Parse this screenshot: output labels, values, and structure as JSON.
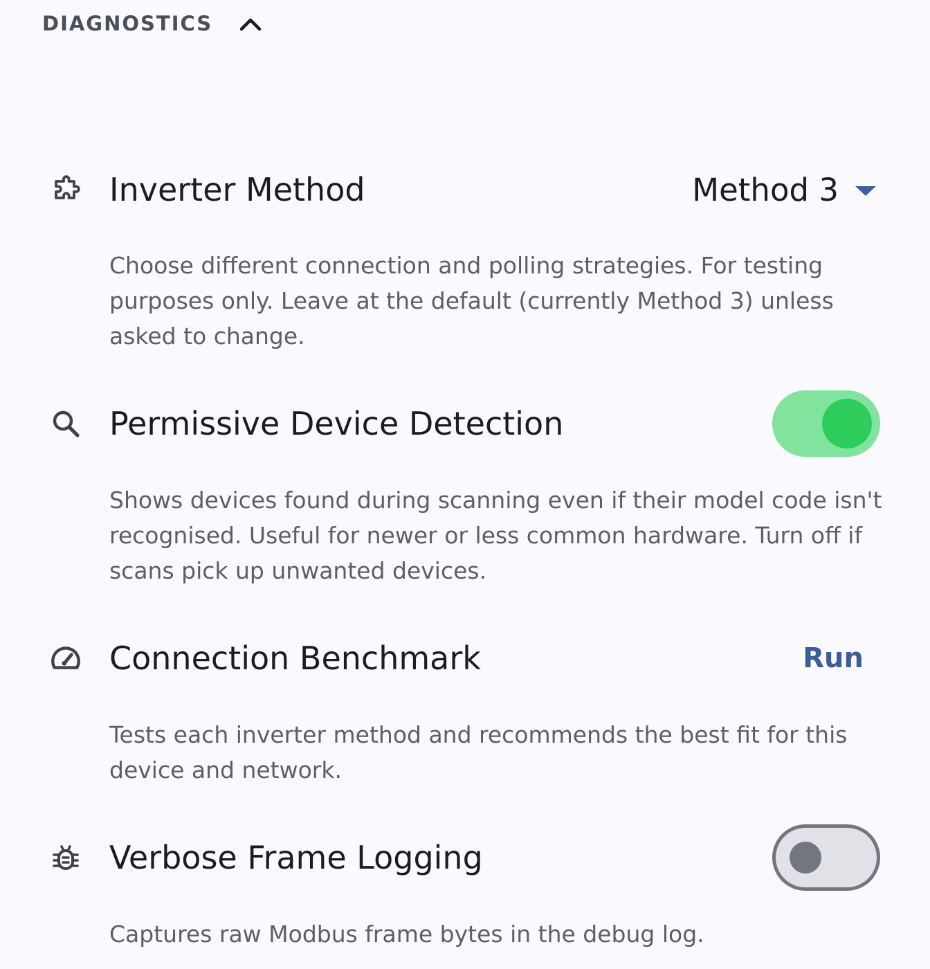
{
  "section": {
    "title": "DIAGNOSTICS",
    "expanded": true
  },
  "settings": [
    {
      "icon": "puzzle-piece-icon",
      "title": "Inverter Method",
      "control": "dropdown",
      "value": "Method 3",
      "description": "Choose different connection and polling strategies. For testing purposes only. Leave at the default (currently Method 3) unless asked to change."
    },
    {
      "icon": "search-icon",
      "title": "Permissive Device Detection",
      "control": "switch",
      "enabled": true,
      "description": "Shows devices found during scanning even if their model code isn't recognised. Useful for newer or less common hardware. Turn off if scans pick up unwanted devices."
    },
    {
      "icon": "speedometer-icon",
      "title": "Connection Benchmark",
      "control": "button",
      "button_label": "Run",
      "description": "Tests each inverter method and recommends the best fit for this device and network."
    },
    {
      "icon": "bug-icon",
      "title": "Verbose Frame Logging",
      "control": "switch",
      "enabled": false,
      "description": "Captures raw Modbus frame bytes in the debug log."
    }
  ],
  "colors": {
    "background": "#f9f9fe",
    "accent": "#3c5d95",
    "switch_on_track": "#82e39e",
    "switch_on_thumb": "#2ecc5a",
    "switch_off_track": "#e1e2e8",
    "switch_off_thumb": "#74767d",
    "secondary_text": "#5c5f66"
  }
}
